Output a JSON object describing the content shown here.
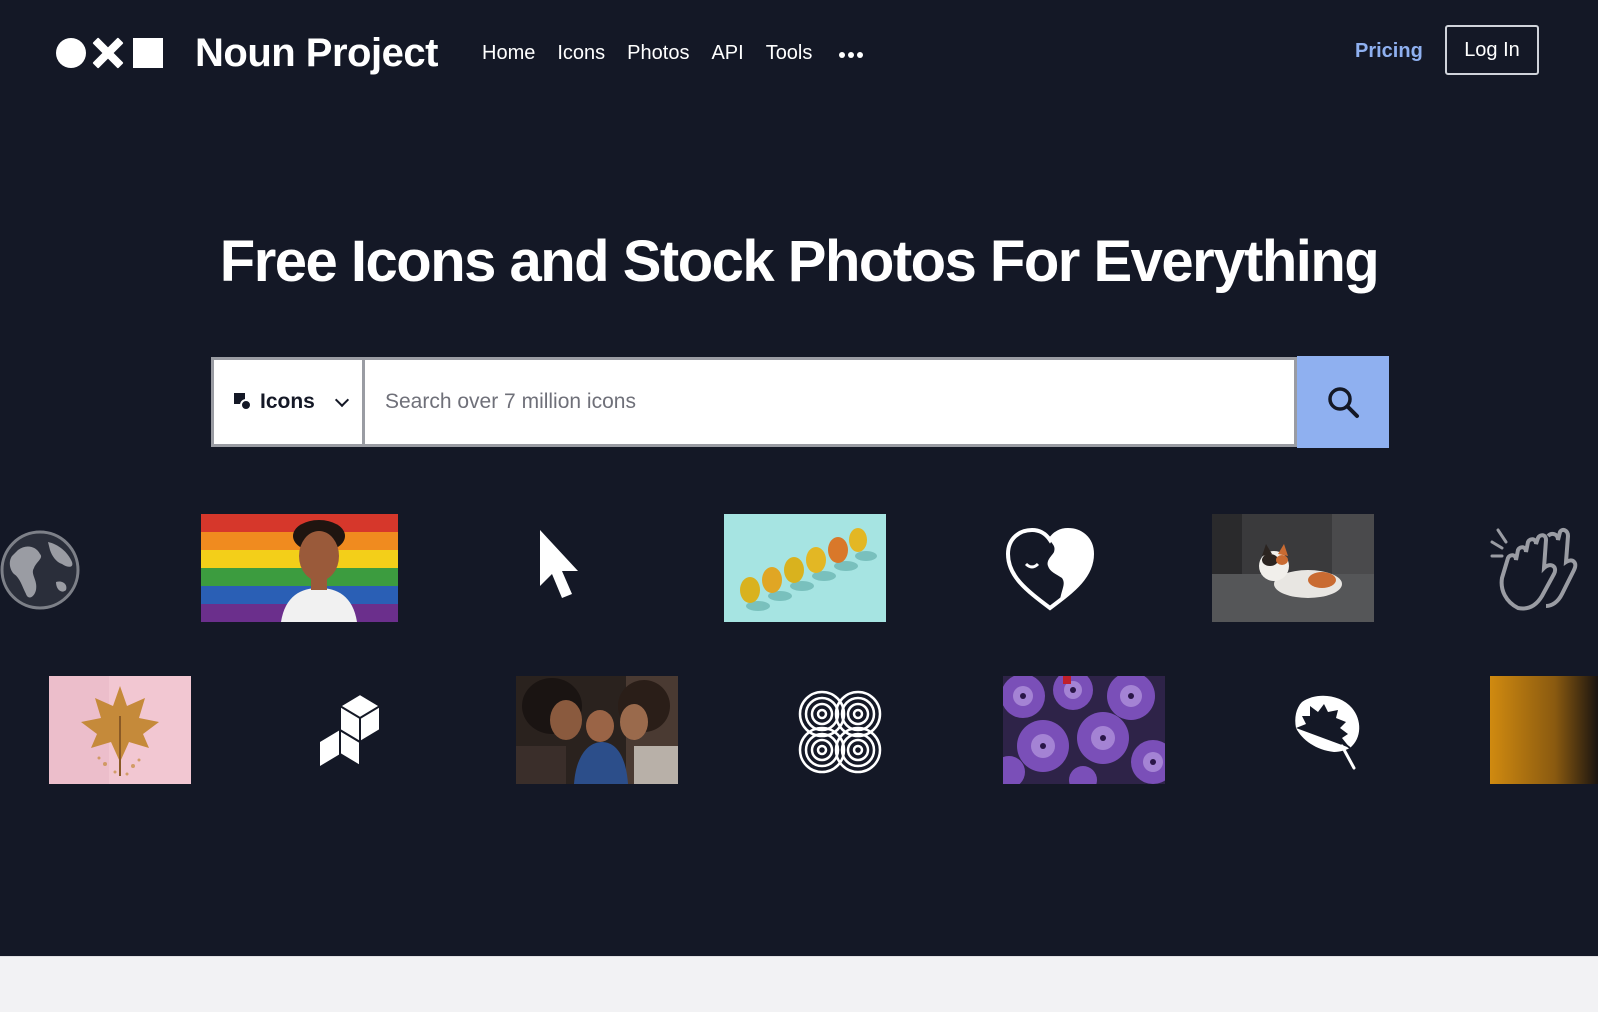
{
  "header": {
    "brand": "Noun Project",
    "nav": [
      "Home",
      "Icons",
      "Photos",
      "API",
      "Tools"
    ],
    "more_icon": "ellipsis-icon",
    "pricing": "Pricing",
    "login": "Log In"
  },
  "hero": {
    "headline": "Free Icons and Stock Photos For Everything"
  },
  "search": {
    "type_label": "Icons",
    "placeholder": "Search over 7 million icons",
    "value": ""
  },
  "colors": {
    "background": "#141826",
    "accent": "#8fb0f0",
    "text": "#ffffff"
  },
  "gallery": {
    "row1": [
      "globe-icon",
      "pride-flag-portrait-photo",
      "cursor-icon",
      "pears-photo",
      "heart-face-icon",
      "calico-cat-photo",
      "clapping-hands-icon"
    ],
    "row2": [
      "autumn-leaf-photo",
      "isometric-blocks-icon",
      "family-baby-photo",
      "interlaced-circles-icon",
      "purple-petunias-photo",
      "monstera-leaf-icon",
      "golden-photo"
    ]
  }
}
